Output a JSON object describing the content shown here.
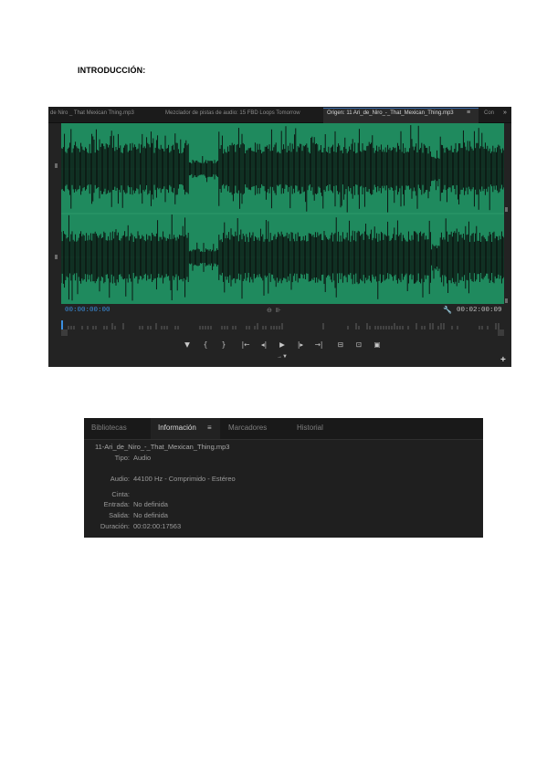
{
  "document": {
    "heading": "INTRODUCCIÓN:"
  },
  "monitor": {
    "tabs": [
      "de Niro _ That Mexican Thing.mp3",
      "Mezclador de pistas de audio: 15 FBD Loops Tomorrow",
      "Origen: 11 Ari_de_Niro_-_That_Mexican_Thing.mp3",
      "Con"
    ],
    "tab_menu": "≡",
    "tab_overflow": "»",
    "timecode_in": "00:00:00:00",
    "timecode_out": "00:02:00:09",
    "colors": {
      "waveform_bg": "#1f8a5e",
      "waveform": "#0a0a0a",
      "timecode_active": "#3b8fe0"
    },
    "controls": [
      "marker-icon",
      "mark-in-icon",
      "mark-out-icon",
      "go-to-in-icon",
      "step-back-icon",
      "play-icon",
      "step-forward-icon",
      "go-to-out-icon",
      "insert-icon",
      "overwrite-icon",
      "export-frame-icon"
    ]
  },
  "info": {
    "tabs": [
      "Bibliotecas",
      "Información",
      "Marcadores",
      "Historial"
    ],
    "active_tab": "Información",
    "menu_glyph": "≡",
    "clip_name": "11-Ari_de_Niro_-_That_Mexican_Thing.mp3",
    "fields": [
      {
        "label": "Tipo:",
        "value": "Audio"
      },
      {
        "label": "Audio:",
        "value": "44100 Hz - Comprimido - Estéreo"
      },
      {
        "label": "Cinta:",
        "value": ""
      },
      {
        "label": "Entrada:",
        "value": "No definida"
      },
      {
        "label": "Salida:",
        "value": "No definida"
      },
      {
        "label": "Duración:",
        "value": "00:02:00:17563"
      }
    ]
  }
}
